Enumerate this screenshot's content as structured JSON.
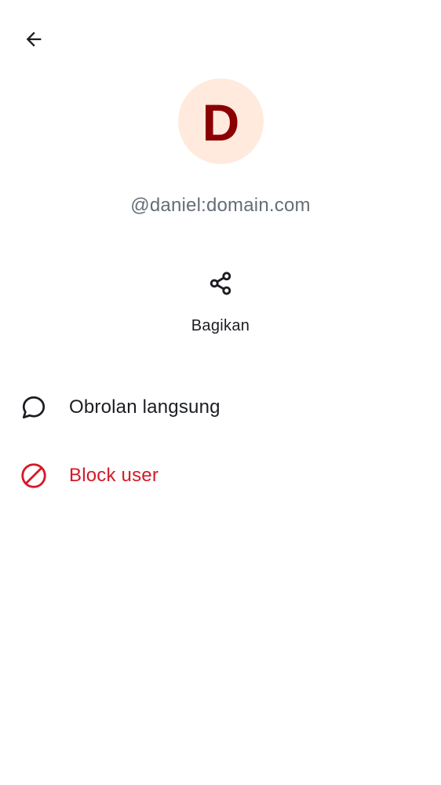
{
  "header": {
    "back_icon": "arrow-left-icon"
  },
  "profile": {
    "avatar_initial": "D",
    "avatar_bg": "#ffeadd",
    "avatar_fg": "#8b0000",
    "user_id": "@daniel:domain.com"
  },
  "actions": {
    "share_icon": "share-icon",
    "share_label": "Bagikan"
  },
  "menu": {
    "direct_chat": {
      "icon": "chat-bubble-icon",
      "label": "Obrolan langsung"
    },
    "block_user": {
      "icon": "block-icon",
      "label": "Block user",
      "color": "#d51928"
    }
  }
}
